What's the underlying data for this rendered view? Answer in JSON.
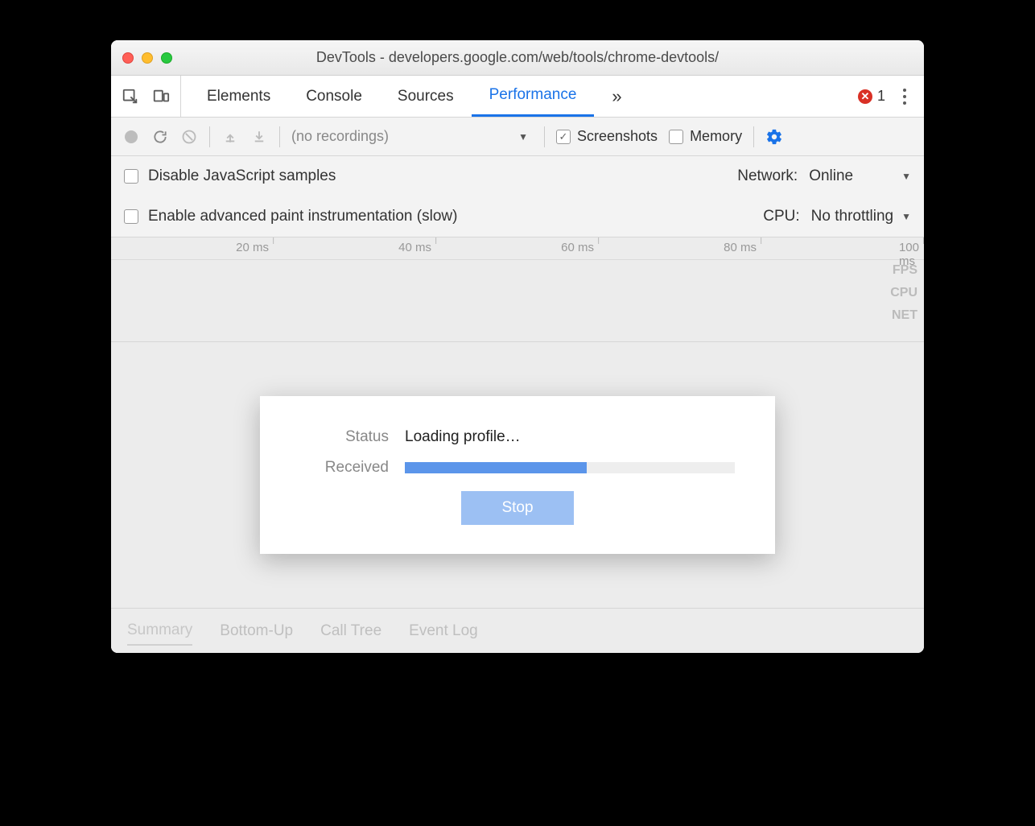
{
  "window": {
    "title": "DevTools - developers.google.com/web/tools/chrome-devtools/"
  },
  "tabs": {
    "items": [
      "Elements",
      "Console",
      "Sources",
      "Performance"
    ],
    "active": "Performance",
    "errorCount": "1"
  },
  "toolbar": {
    "recordings_label": "(no recordings)",
    "screenshots_label": "Screenshots",
    "memory_label": "Memory"
  },
  "settings": {
    "disable_js_label": "Disable JavaScript samples",
    "paint_instr_label": "Enable advanced paint instrumentation (slow)",
    "network_label": "Network:",
    "network_value": "Online",
    "cpu_label": "CPU:",
    "cpu_value": "No throttling"
  },
  "timeline": {
    "ticks": [
      "20 ms",
      "40 ms",
      "60 ms",
      "80 ms",
      "100 ms"
    ],
    "lanes": [
      "FPS",
      "CPU",
      "NET"
    ]
  },
  "modal": {
    "status_label": "Status",
    "status_value": "Loading profile…",
    "received_label": "Received",
    "progress_percent": 55,
    "stop_label": "Stop"
  },
  "bottomTabs": {
    "items": [
      "Summary",
      "Bottom-Up",
      "Call Tree",
      "Event Log"
    ],
    "active": "Summary"
  }
}
